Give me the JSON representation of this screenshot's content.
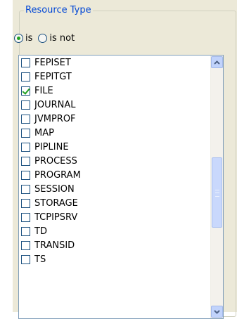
{
  "group": {
    "title": "Resource Type"
  },
  "radio": {
    "is_label": "is",
    "is_not_label": "is not",
    "selected": "is"
  },
  "list": {
    "items": [
      {
        "label": "FEPISET",
        "checked": false
      },
      {
        "label": "FEPITGT",
        "checked": false
      },
      {
        "label": "FILE",
        "checked": true
      },
      {
        "label": "JOURNAL",
        "checked": false
      },
      {
        "label": "JVMPROF",
        "checked": false
      },
      {
        "label": "MAP",
        "checked": false
      },
      {
        "label": "PIPLINE",
        "checked": false
      },
      {
        "label": "PROCESS",
        "checked": false
      },
      {
        "label": "PROGRAM",
        "checked": false
      },
      {
        "label": "SESSION",
        "checked": false
      },
      {
        "label": "STORAGE",
        "checked": false
      },
      {
        "label": "TCPIPSRV",
        "checked": false
      },
      {
        "label": "TD",
        "checked": false
      },
      {
        "label": "TRANSID",
        "checked": false
      },
      {
        "label": "TS",
        "checked": false
      }
    ]
  },
  "colors": {
    "panel_bg": "#ece9d8",
    "legend_text": "#0046d5",
    "check_mark": "#21a121",
    "list_border": "#7f9db9"
  }
}
